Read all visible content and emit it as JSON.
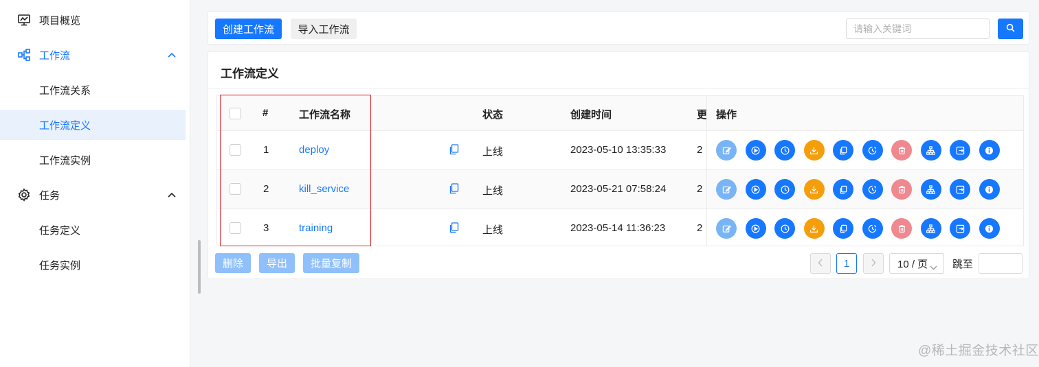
{
  "sidebar": {
    "items": [
      {
        "label": "项目概览",
        "icon": "dashboard-icon"
      },
      {
        "label": "工作流",
        "icon": "workflow-icon",
        "expanded": true
      },
      {
        "label": "工作流关系"
      },
      {
        "label": "工作流定义",
        "active": true
      },
      {
        "label": "工作流实例"
      },
      {
        "label": "任务",
        "icon": "gear-icon",
        "expanded": true
      },
      {
        "label": "任务定义"
      },
      {
        "label": "任务实例"
      }
    ]
  },
  "toolbar": {
    "create_label": "创建工作流",
    "import_label": "导入工作流",
    "search_placeholder": "请输入关键词"
  },
  "card": {
    "title": "工作流定义"
  },
  "table": {
    "headers": {
      "index": "#",
      "name": "工作流名称",
      "status": "状态",
      "created": "创建时间",
      "clipped": "更",
      "ops": "操作"
    },
    "rows": [
      {
        "index": "1",
        "name": "deploy",
        "status": "上线",
        "created": "2023-05-10 13:35:33",
        "clipped": "2"
      },
      {
        "index": "2",
        "name": "kill_service",
        "status": "上线",
        "created": "2023-05-21 07:58:24",
        "clipped": "2"
      },
      {
        "index": "3",
        "name": "training",
        "status": "上线",
        "created": "2023-05-14 11:36:23",
        "clipped": "2"
      }
    ],
    "op_icons": [
      "edit-icon",
      "play-icon",
      "clock-icon",
      "download-icon",
      "copy-icon",
      "timing-icon",
      "delete-icon",
      "tree-icon",
      "export-icon",
      "info-icon"
    ]
  },
  "footer": {
    "delete_label": "删除",
    "export_label": "导出",
    "batch_copy_label": "批量复制",
    "current_page": "1",
    "page_size": "10 / 页",
    "jump_label": "跳至"
  },
  "colors": {
    "primary": "#1677ff",
    "orange": "#f59e0b",
    "pink": "#f0888f",
    "light_blue": "#79b4f7",
    "highlight_border": "#e2262d"
  },
  "watermark": "@稀土掘金技术社区"
}
